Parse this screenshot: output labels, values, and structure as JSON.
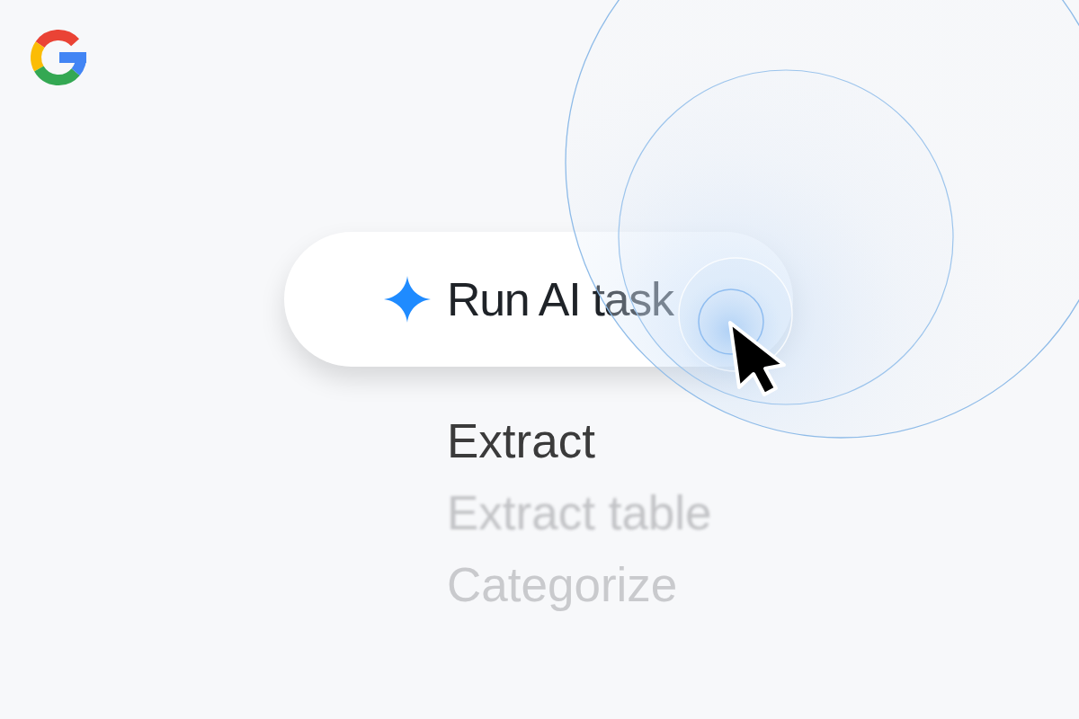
{
  "action_button": {
    "label": "Run AI task"
  },
  "menu_items": [
    {
      "label": "Extract",
      "kind": "focused"
    },
    {
      "label": "Extract table",
      "kind": "blurred"
    },
    {
      "label": "Categorize",
      "kind": "faded"
    }
  ]
}
